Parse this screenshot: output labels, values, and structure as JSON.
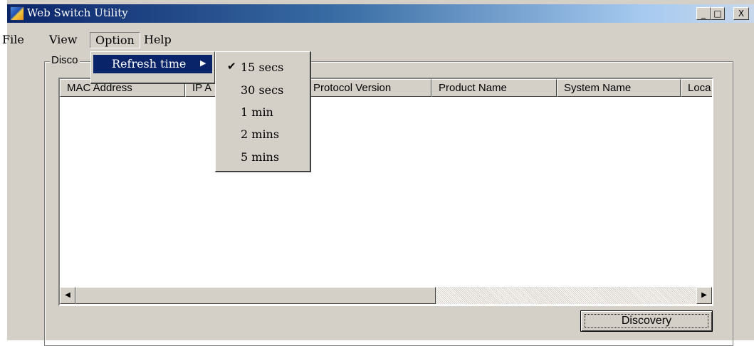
{
  "window": {
    "title": "Web Switch Utility",
    "controls": {
      "minimize": "_",
      "maximize": "□",
      "close": "X"
    }
  },
  "menubar": {
    "items": [
      {
        "label": "File"
      },
      {
        "label": "View"
      },
      {
        "label": "Option",
        "state": "open"
      },
      {
        "label": "Help"
      }
    ]
  },
  "option_menu": {
    "items": [
      {
        "label": "Refresh time",
        "has_submenu": true,
        "highlighted": true
      }
    ],
    "submenu_arrow": "▶"
  },
  "refresh_submenu": {
    "items": [
      {
        "label": "15 secs",
        "checked": true
      },
      {
        "label": "30 secs",
        "checked": false
      },
      {
        "label": "1 min",
        "checked": false
      },
      {
        "label": "2 mins",
        "checked": false
      },
      {
        "label": "5 mins",
        "checked": false
      }
    ],
    "check_mark": "✔"
  },
  "discovery_group": {
    "label_visible": "Disco",
    "columns": [
      "MAC Address",
      "IP A",
      "",
      "Protocol Version",
      "Product Name",
      "System Name",
      "Loca"
    ],
    "rows": [],
    "scroll_left": "◀",
    "scroll_right": "▶"
  },
  "buttons": {
    "discovery": "Discovery"
  },
  "colors": {
    "face": "#d4d0c8",
    "highlight": "#0a246a",
    "title_start": "#0a246a",
    "title_end": "#a6caf0"
  }
}
